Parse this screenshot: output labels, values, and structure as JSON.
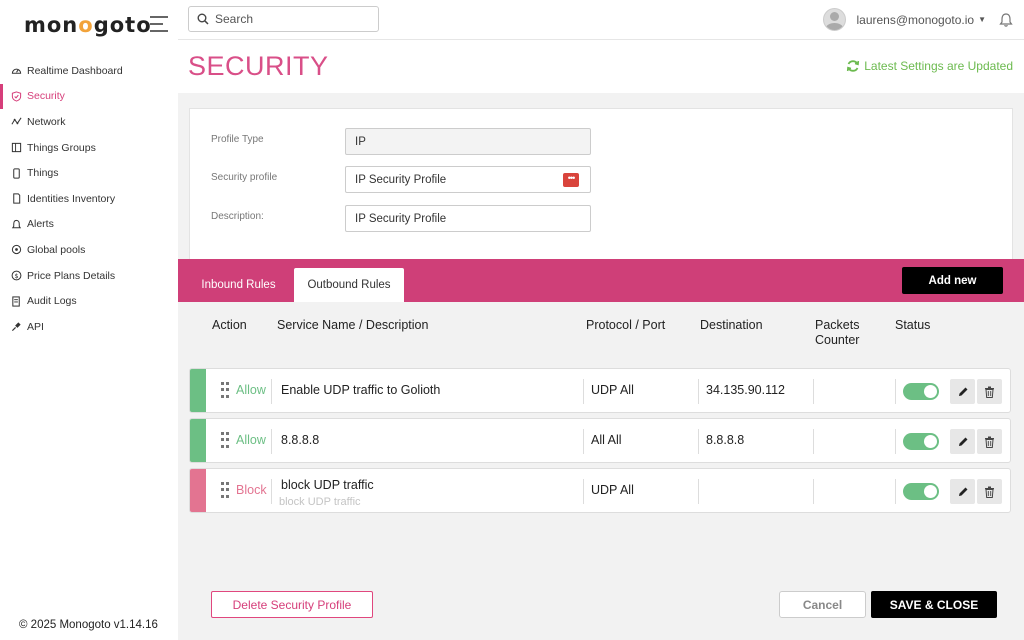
{
  "brand": {
    "logo_text": "monogoto",
    "accent_color": "#d63e7a"
  },
  "sidebar": {
    "items": [
      {
        "label": "Realtime Dashboard",
        "icon": "gauge-icon",
        "active": false
      },
      {
        "label": "Security",
        "icon": "shield-icon",
        "active": true
      },
      {
        "label": "Network",
        "icon": "network-icon",
        "active": false
      },
      {
        "label": "Things Groups",
        "icon": "folder-icon",
        "active": false
      },
      {
        "label": "Things",
        "icon": "phone-icon",
        "active": false
      },
      {
        "label": "Identities Inventory",
        "icon": "sim-icon",
        "active": false
      },
      {
        "label": "Alerts",
        "icon": "bell-icon",
        "active": false
      },
      {
        "label": "Global pools",
        "icon": "globe-icon",
        "active": false
      },
      {
        "label": "Price Plans Details",
        "icon": "dollar-icon",
        "active": false
      },
      {
        "label": "Audit Logs",
        "icon": "log-icon",
        "active": false
      },
      {
        "label": "API",
        "icon": "plug-icon",
        "active": false
      }
    ],
    "copyright": "© 2025 Monogoto v1.14.16"
  },
  "topbar": {
    "search_placeholder": "Search",
    "user_email": "laurens@monogoto.io"
  },
  "page": {
    "title": "SECURITY",
    "status_text": "Latest Settings are Updated",
    "status_color": "#6cba4f"
  },
  "profile": {
    "type_label": "Profile Type",
    "type_value": "IP",
    "profile_label": "Security profile",
    "profile_value": "IP Security Profile",
    "description_label": "Description:",
    "description_value": "IP Security Profile"
  },
  "tabs": {
    "inbound": "Inbound Rules",
    "outbound": "Outbound Rules",
    "active": "outbound",
    "add_new": "Add new"
  },
  "table": {
    "headers": {
      "action": "Action",
      "service": "Service Name / Description",
      "protocol": "Protocol / Port",
      "destination": "Destination",
      "packets": "Packets Counter",
      "status": "Status"
    },
    "rows": [
      {
        "action": "Allow",
        "type": "allow",
        "service": "Enable UDP traffic to Golioth",
        "description": "",
        "protocol": "UDP All",
        "destination": "34.135.90.112",
        "packets": "",
        "enabled": true
      },
      {
        "action": "Allow",
        "type": "allow",
        "service": "8.8.8.8",
        "description": "",
        "protocol": "All All",
        "destination": "8.8.8.8",
        "packets": "",
        "enabled": true
      },
      {
        "action": "Block",
        "type": "block",
        "service": "block UDP traffic",
        "description": "block UDP traffic",
        "protocol": "UDP All",
        "destination": "",
        "packets": "",
        "enabled": true
      }
    ]
  },
  "footer": {
    "delete_label": "Delete Security Profile",
    "cancel_label": "Cancel",
    "save_label": "SAVE & CLOSE"
  }
}
